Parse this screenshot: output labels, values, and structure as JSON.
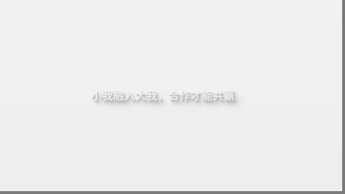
{
  "slide": {
    "tagline": "小我融入大我，合作才能共赢"
  }
}
